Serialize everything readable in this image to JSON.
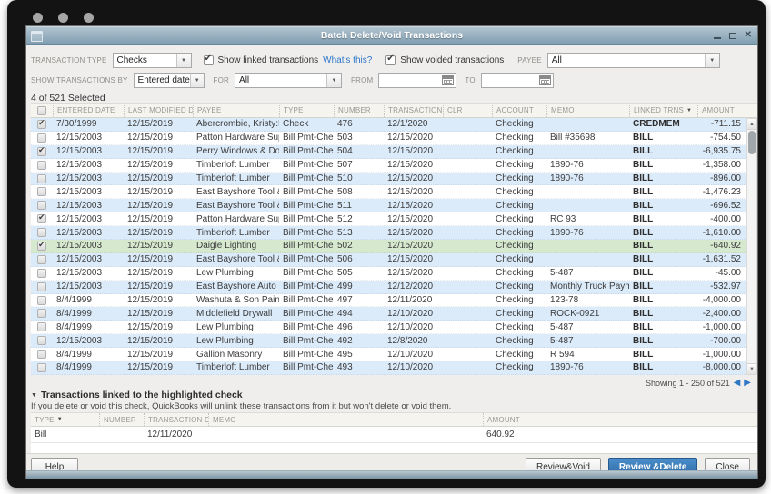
{
  "window": {
    "title": "Batch Delete/Void Transactions",
    "selected_summary": "4 of 521 Selected",
    "paging_text": "Showing 1 - 250 of 521"
  },
  "filters": {
    "transaction_type_label": "TRANSACTION TYPE",
    "transaction_type_value": "Checks",
    "show_linked_label": "Show linked transactions",
    "whats_this_label": "What's this?",
    "show_linked_checked": true,
    "show_voided_label": "Show voided transactions",
    "show_voided_checked": true,
    "payee_label": "PAYEE",
    "payee_value": "All",
    "show_by_label": "SHOW TRANSACTIONS BY",
    "show_by_value": "Entered date",
    "for_label": "FOR",
    "for_value": "All",
    "from_label": "FROM",
    "from_value": "",
    "to_label": "TO",
    "to_value": ""
  },
  "main_table": {
    "columns": [
      "ENTERED DATE",
      "LAST MODIFIED DATE",
      "PAYEE",
      "TYPE",
      "NUMBER",
      "TRANSACTION DATE",
      "CLR",
      "ACCOUNT",
      "MEMO",
      "LINKED TRNS",
      "AMOUNT"
    ],
    "sort_column": "LINKED TRNS",
    "highlighted_row": 9,
    "rows": [
      {
        "checked": true,
        "entered_date": "7/30/1999",
        "last_modified_date": "12/15/2019",
        "payee": "Abercrombie, Kristy:Remo...",
        "type": "Check",
        "number": "476",
        "transaction_date": "12/1/2020",
        "clr": "",
        "account": "Checking",
        "memo": "",
        "linked_trns": "CREDMEM",
        "amount": "-711.15"
      },
      {
        "checked": false,
        "entered_date": "12/15/2003",
        "last_modified_date": "12/15/2019",
        "payee": "Patton Hardware Supplies",
        "type": "Bill Pmt-Check",
        "number": "503",
        "transaction_date": "12/15/2020",
        "clr": "",
        "account": "Checking",
        "memo": "Bill #35698",
        "linked_trns": "BILL",
        "amount": "-754.50"
      },
      {
        "checked": true,
        "entered_date": "12/15/2003",
        "last_modified_date": "12/15/2019",
        "payee": "Perry Windows & Doors",
        "type": "Bill Pmt-Check",
        "number": "504",
        "transaction_date": "12/15/2020",
        "clr": "",
        "account": "Checking",
        "memo": "",
        "linked_trns": "BILL",
        "amount": "-6,935.75"
      },
      {
        "checked": false,
        "entered_date": "12/15/2003",
        "last_modified_date": "12/15/2019",
        "payee": "Timberloft Lumber",
        "type": "Bill Pmt-Check",
        "number": "507",
        "transaction_date": "12/15/2020",
        "clr": "",
        "account": "Checking",
        "memo": "1890-76",
        "linked_trns": "BILL",
        "amount": "-1,358.00"
      },
      {
        "checked": false,
        "entered_date": "12/15/2003",
        "last_modified_date": "12/15/2019",
        "payee": "Timberloft Lumber",
        "type": "Bill Pmt-Check",
        "number": "510",
        "transaction_date": "12/15/2020",
        "clr": "",
        "account": "Checking",
        "memo": "1890-76",
        "linked_trns": "BILL",
        "amount": "-896.00"
      },
      {
        "checked": false,
        "entered_date": "12/15/2003",
        "last_modified_date": "12/15/2019",
        "payee": "East Bayshore Tool & Sup...",
        "type": "Bill Pmt-Check",
        "number": "508",
        "transaction_date": "12/15/2020",
        "clr": "",
        "account": "Checking",
        "memo": "",
        "linked_trns": "BILL",
        "amount": "-1,476.23"
      },
      {
        "checked": false,
        "entered_date": "12/15/2003",
        "last_modified_date": "12/15/2019",
        "payee": "East Bayshore Tool & Sup...",
        "type": "Bill Pmt-Check",
        "number": "511",
        "transaction_date": "12/15/2020",
        "clr": "",
        "account": "Checking",
        "memo": "",
        "linked_trns": "BILL",
        "amount": "-696.52"
      },
      {
        "checked": true,
        "entered_date": "12/15/2003",
        "last_modified_date": "12/15/2019",
        "payee": "Patton Hardware Supplies",
        "type": "Bill Pmt-Check",
        "number": "512",
        "transaction_date": "12/15/2020",
        "clr": "",
        "account": "Checking",
        "memo": "RC 93",
        "linked_trns": "BILL",
        "amount": "-400.00"
      },
      {
        "checked": false,
        "entered_date": "12/15/2003",
        "last_modified_date": "12/15/2019",
        "payee": "Timberloft Lumber",
        "type": "Bill Pmt-Check",
        "number": "513",
        "transaction_date": "12/15/2020",
        "clr": "",
        "account": "Checking",
        "memo": "1890-76",
        "linked_trns": "BILL",
        "amount": "-1,610.00"
      },
      {
        "checked": true,
        "entered_date": "12/15/2003",
        "last_modified_date": "12/15/2019",
        "payee": "Daigle Lighting",
        "type": "Bill Pmt-Check",
        "number": "502",
        "transaction_date": "12/15/2020",
        "clr": "",
        "account": "Checking",
        "memo": "",
        "linked_trns": "BILL",
        "amount": "-640.92"
      },
      {
        "checked": false,
        "entered_date": "12/15/2003",
        "last_modified_date": "12/15/2019",
        "payee": "East Bayshore Tool & Sup...",
        "type": "Bill Pmt-Check",
        "number": "506",
        "transaction_date": "12/15/2020",
        "clr": "",
        "account": "Checking",
        "memo": "",
        "linked_trns": "BILL",
        "amount": "-1,631.52"
      },
      {
        "checked": false,
        "entered_date": "12/15/2003",
        "last_modified_date": "12/15/2019",
        "payee": "Lew Plumbing",
        "type": "Bill Pmt-Check",
        "number": "505",
        "transaction_date": "12/15/2020",
        "clr": "",
        "account": "Checking",
        "memo": "5-487",
        "linked_trns": "BILL",
        "amount": "-45.00"
      },
      {
        "checked": false,
        "entered_date": "12/15/2003",
        "last_modified_date": "12/15/2019",
        "payee": "East Bayshore Auto Mall",
        "type": "Bill Pmt-Check",
        "number": "499",
        "transaction_date": "12/12/2020",
        "clr": "",
        "account": "Checking",
        "memo": "Monthly Truck Payment",
        "linked_trns": "BILL",
        "amount": "-532.97"
      },
      {
        "checked": false,
        "entered_date": "8/4/1999",
        "last_modified_date": "12/15/2019",
        "payee": "Washuta & Son Painting",
        "type": "Bill Pmt-Check",
        "number": "497",
        "transaction_date": "12/11/2020",
        "clr": "",
        "account": "Checking",
        "memo": "123-78",
        "linked_trns": "BILL",
        "amount": "-4,000.00"
      },
      {
        "checked": false,
        "entered_date": "8/4/1999",
        "last_modified_date": "12/15/2019",
        "payee": "Middlefield Drywall",
        "type": "Bill Pmt-Check",
        "number": "494",
        "transaction_date": "12/10/2020",
        "clr": "",
        "account": "Checking",
        "memo": "ROCK-0921",
        "linked_trns": "BILL",
        "amount": "-2,400.00"
      },
      {
        "checked": false,
        "entered_date": "8/4/1999",
        "last_modified_date": "12/15/2019",
        "payee": "Lew Plumbing",
        "type": "Bill Pmt-Check",
        "number": "496",
        "transaction_date": "12/10/2020",
        "clr": "",
        "account": "Checking",
        "memo": "5-487",
        "linked_trns": "BILL",
        "amount": "-1,000.00"
      },
      {
        "checked": false,
        "entered_date": "12/15/2003",
        "last_modified_date": "12/15/2019",
        "payee": "Lew Plumbing",
        "type": "Bill Pmt-Check",
        "number": "492",
        "transaction_date": "12/8/2020",
        "clr": "",
        "account": "Checking",
        "memo": "5-487",
        "linked_trns": "BILL",
        "amount": "-700.00"
      },
      {
        "checked": false,
        "entered_date": "8/4/1999",
        "last_modified_date": "12/15/2019",
        "payee": "Gallion Masonry",
        "type": "Bill Pmt-Check",
        "number": "495",
        "transaction_date": "12/10/2020",
        "clr": "",
        "account": "Checking",
        "memo": "R 594",
        "linked_trns": "BILL",
        "amount": "-1,000.00"
      },
      {
        "checked": false,
        "entered_date": "8/4/1999",
        "last_modified_date": "12/15/2019",
        "payee": "Timberloft Lumber",
        "type": "Bill Pmt-Check",
        "number": "493",
        "transaction_date": "12/10/2020",
        "clr": "",
        "account": "Checking",
        "memo": "1890-76",
        "linked_trns": "BILL",
        "amount": "-8,000.00"
      }
    ]
  },
  "linked_section": {
    "title": "Transactions linked to the highlighted check",
    "description": "If you delete or void this check, QuickBooks will unlink these transactions from it but won't delete or void them.",
    "columns": [
      "TYPE",
      "NUMBER",
      "TRANSACTION DATE",
      "MEMO",
      "AMOUNT"
    ],
    "sort_column": "TYPE",
    "rows": [
      {
        "type": "Bill",
        "number": "",
        "transaction_date": "12/11/2020",
        "memo": "",
        "amount": "640.92"
      }
    ]
  },
  "footer": {
    "help_label": "Help",
    "review_void_label": "Review & Void",
    "review_void_accel": "&",
    "review_delete_label": "Review & Delete",
    "review_delete_accel": "D",
    "close_label": "Close"
  },
  "colors": {
    "titlebar_top": "#b4c6d1",
    "titlebar_bottom": "#7e9cb0",
    "row_stripe_blue": "#dcebfa",
    "highlight_green": "#d6e9cf",
    "primary_button_blue": "#2e6ca7",
    "link_blue": "#2f77c9",
    "paging_arrow_blue": "#2e77c5"
  }
}
